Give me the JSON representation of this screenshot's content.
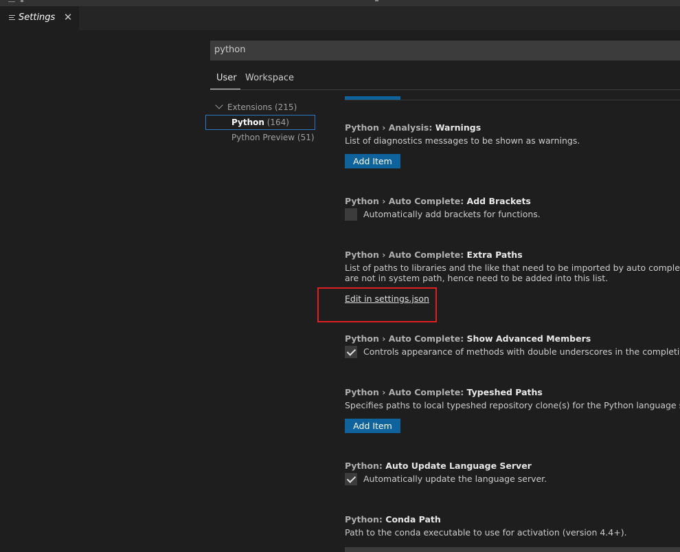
{
  "tab": {
    "label": "Settings",
    "close": "✕"
  },
  "search": {
    "value": "python"
  },
  "scope": {
    "user": "User",
    "workspace": "Workspace"
  },
  "toc": {
    "extensions": "Extensions (215)",
    "python_name": "Python",
    "python_count": " (164)",
    "python_preview": "Python Preview (51)"
  },
  "settings": [
    {
      "category": "Python › Analysis: ",
      "name": "Warnings",
      "description": "List of diagnostics messages to be shown as warnings.",
      "control": "Add Item"
    },
    {
      "category": "Python › Auto Complete: ",
      "name": "Add Brackets",
      "description": "Automatically add brackets for functions.",
      "checked": false
    },
    {
      "category": "Python › Auto Complete: ",
      "name": "Extra Paths",
      "description_line1": "List of paths to libraries and the like that need to be imported by auto complete engi",
      "description_line2": "are not in system path, hence need to be added into this list.",
      "link": "Edit in settings.json"
    },
    {
      "category": "Python › Auto Complete: ",
      "name": "Show Advanced Members",
      "description": "Controls appearance of methods with double underscores in the completion list.",
      "checked": true
    },
    {
      "category": "Python › Auto Complete: ",
      "name": "Typeshed Paths",
      "description": "Specifies paths to local typeshed repository clone(s) for the Python language server.",
      "control": "Add Item"
    },
    {
      "category": "Python: ",
      "name": "Auto Update Language Server",
      "description": "Automatically update the language server.",
      "checked": true
    },
    {
      "category": "Python: ",
      "name": "Conda Path",
      "description": "Path to the conda executable to use for activation (version 4.4+)."
    }
  ],
  "colors": {
    "background": "#1e1e1e",
    "button": "#0e639c",
    "focus_border": "#2b79c2",
    "highlight": "#e02020"
  }
}
